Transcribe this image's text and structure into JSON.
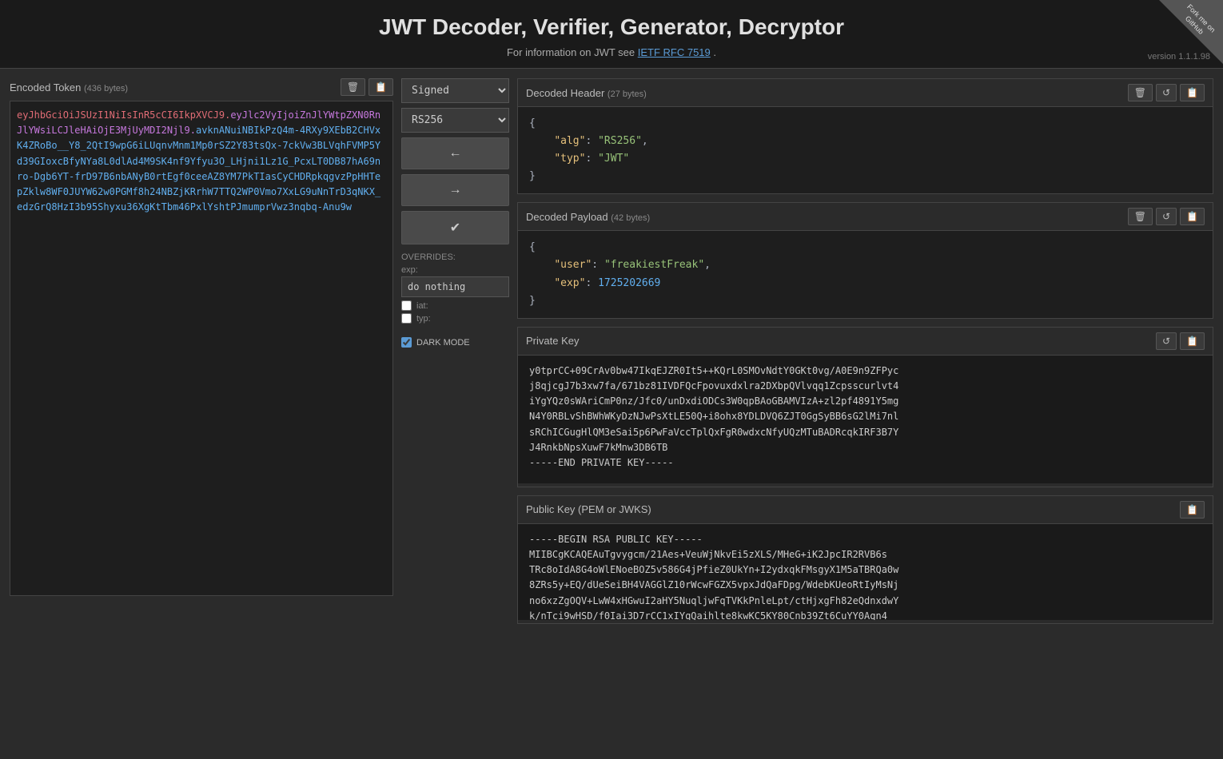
{
  "header": {
    "title": "JWT Decoder, Verifier, Generator, Decryptor",
    "subtitle": "For information on JWT see ",
    "link_text": "IETF RFC 7519",
    "link_url": "#",
    "subtitle_end": ".",
    "version": "version 1.1.1.98",
    "github_text": "Fork me on GitHub"
  },
  "encoded_panel": {
    "title": "Encoded Token",
    "bytes": "(436 bytes)",
    "token_part1": "eyJhbGciOiJSUzI1NiIsInR5cCI6IkpXVCJ9.",
    "token_part2": "eyJlc2VyIjoiZnJlYWtpZXN0RnJlYWsiLCJleHAiOjE3MjUyMDI2Njl9.",
    "token_part3": "avknANuiNBIkPzQ4m-4RXy9XEbB2CHVxK4ZRoBo__Y8_2QtI9wpG6iLUqnvMnm1Mp0rSZ2Y83tsQx-7ckVw3BLVqhFVMP5Yd39GIoxcBfyNYa8L0dlAd4M9SK4nf9Yfyu3O_LHjni1Lz1G_PcxLT0DB87hA69nro-Dgb6YT-frD97B6nbANyB0rtEgf0ceeAZ8YM7PkTIasCyCHDRpkqgvzPpHHTepZklw8WF0JUYW62w0PGMf8h24NBZjKRrhW7TTQ2WP0Vmo7XxLG9uNnTrD3qNKX_edzGrQ8HzI3b95Shyxu36XgKtTbm46PxlYshtPJmumprVwz3nqbq-Anu9w"
  },
  "middle": {
    "type_value": "Signed",
    "algo_value": "RS256",
    "left_arrow": "←",
    "right_arrow": "→",
    "checkmark": "✔",
    "overrides_label": "OVERRIDES:",
    "exp_label": "exp:",
    "exp_value": "do nothing",
    "iat_label": "iat:",
    "typ_label": "typ:",
    "dark_mode_label": "DARK MODE"
  },
  "decoded_header": {
    "title": "Decoded Header",
    "bytes": "(27 bytes)",
    "content": "{\n  \"alg\": \"RS256\",\n  \"typ\": \"JWT\"\n}",
    "alg_key": "\"alg\"",
    "alg_value": "\"RS256\"",
    "typ_key": "\"typ\"",
    "typ_value": "\"JWT\""
  },
  "decoded_payload": {
    "title": "Decoded Payload",
    "bytes": "(42 bytes)",
    "user_key": "\"user\"",
    "user_value": "\"freakiestFreak\"",
    "exp_key": "\"exp\"",
    "exp_value": "1725202669"
  },
  "private_key": {
    "title": "Private Key",
    "content": "y0tprCC+09CrAv0bw47IkqEJZR0It5++KQrL0SMOvNdtY0GKt0vg/A0E9n9ZFPyc\nj8qjcgJ7b3xw7fa/671bz81IVDFQcFpovuxdxlra2DXbpQVlvqq1Zcpsscurlvt4\niYgYQz0sWAriCmP0nz/Jfc0/unDxdiODCs3W0qpBAoGBAMVIzA+zl2pf4891Y5mg\nN4Y0RBLvShBWhWKyDzNJwPsXtLE50Q+i8ohx8YDLDVQ6ZJT0GgSyBB6sG2lMi7nl\nsRChICGugHlQM3eSai5p6PwFaVccTplQxFgR0wdxcNfyUQzMTuBADRcqkIRF3B7Y\nJ4RnkbNpsXuwF7kMnw3DB6TB\n-----END PRIVATE KEY-----"
  },
  "public_key": {
    "title": "Public Key (PEM or JWKS)",
    "content": "-----BEGIN RSA PUBLIC KEY-----\nMIIBCgKCAQEAuTgvygcm/21Aes+VeuWjNkvEi5zXLS/MHeG+iK2JpcIR2RVB6s\nTRc8oIdA8G4oWlENoeBOZ5v586G4jPfieZ0UkYn+I2ydxqkFMsgyX1M5aTBRQa0w\n8ZRs5y+EQ/dUeSeiBH4VAGGlZ10rWcwFGZX5vpxJdQaFDpg/WdebKUeoRtIyMsNj\nno6xzZgOQV+LwW4xHGwuI2aHY5NuqljwFqTVKkPnleLpt/ctHjxgFh82eQdnxdwY\nk/nTci9wHSD/f0Iai3D7rCC1xIYqQaihlte8kwKC5KY80Cnb39Zt6CuYY0Aqn4"
  },
  "buttons": {
    "delete": "🗑",
    "copy": "📋",
    "refresh": "↺"
  }
}
